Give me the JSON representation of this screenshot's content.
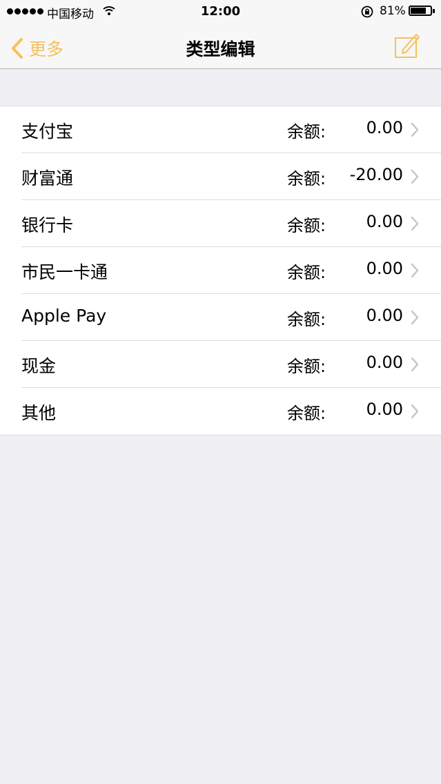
{
  "status_bar": {
    "carrier": "中国移动",
    "time": "12:00",
    "battery_percent": "81%",
    "battery_level": 0.81,
    "icons": [
      "signal-dots-icon",
      "wifi-icon",
      "rotation-lock-icon",
      "battery-icon"
    ]
  },
  "nav": {
    "back_label": "更多",
    "title": "类型编辑",
    "accent_color": "#f5c15a",
    "icons": [
      "chevron-left-icon",
      "compose-icon"
    ]
  },
  "accounts": {
    "balance_label": "余额:",
    "items": [
      {
        "name": "支付宝",
        "value": "0.00"
      },
      {
        "name": "财富通",
        "value": "-20.00"
      },
      {
        "name": "银行卡",
        "value": "0.00"
      },
      {
        "name": "市民一卡通",
        "value": "0.00"
      },
      {
        "name": "Apple Pay",
        "value": "0.00"
      },
      {
        "name": "现金",
        "value": "0.00"
      },
      {
        "name": "其他",
        "value": "0.00"
      }
    ]
  }
}
